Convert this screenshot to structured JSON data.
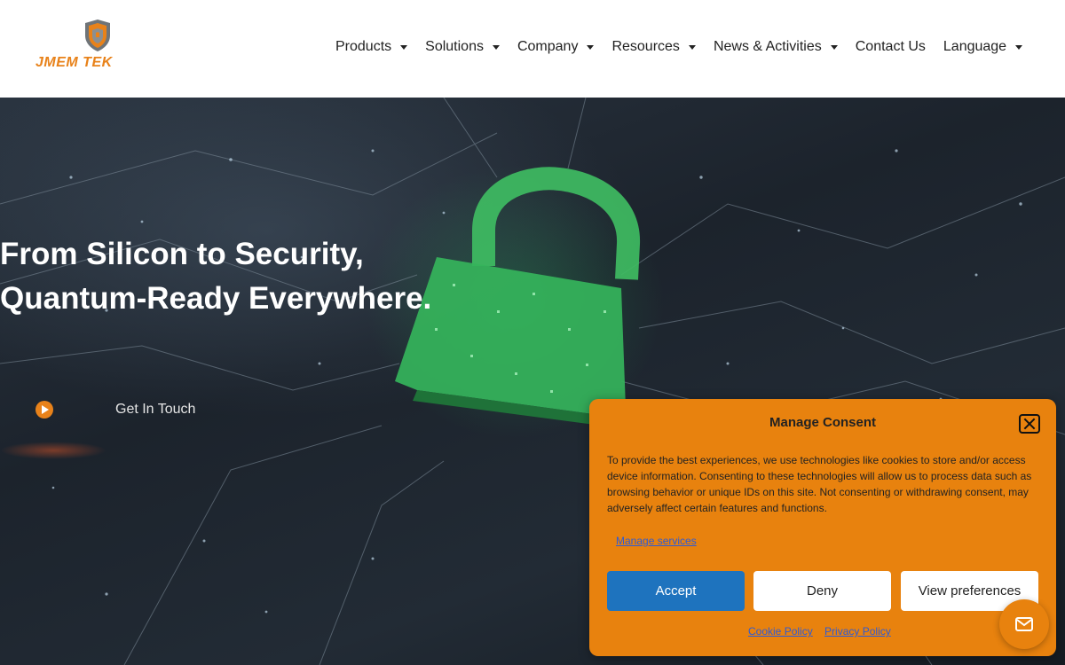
{
  "brand": {
    "name": "JMEM TEK",
    "accent": "#e8821a"
  },
  "nav": {
    "items": [
      {
        "label": "Products",
        "dropdown": true
      },
      {
        "label": "Solutions",
        "dropdown": true
      },
      {
        "label": "Company",
        "dropdown": true
      },
      {
        "label": "Resources",
        "dropdown": true
      },
      {
        "label": "News & Activities",
        "dropdown": true
      },
      {
        "label": "Contact Us",
        "dropdown": false
      },
      {
        "label": "Language",
        "dropdown": true
      }
    ]
  },
  "hero": {
    "title_line1": "From Silicon to Security,",
    "title_line2": "Quantum-Ready Everywhere.",
    "cta_label": "Get In Touch",
    "icons": {
      "cta": "play-icon"
    }
  },
  "consent": {
    "title": "Manage Consent",
    "body": "To provide the best experiences, we use technologies like cookies to store and/or access device information. Consenting to these technologies will allow us to process data such as browsing behavior or unique IDs on this site. Not consenting or withdrawing consent, may adversely affect certain features and functions.",
    "manage_link": "Manage services",
    "accept_label": "Accept",
    "deny_label": "Deny",
    "preferences_label": "View preferences",
    "cookie_policy": "Cookie Policy",
    "privacy_policy": "Privacy Policy",
    "background_color": "#e8820e",
    "accept_color": "#1e73be"
  },
  "floating": {
    "icon": "mail-icon"
  }
}
